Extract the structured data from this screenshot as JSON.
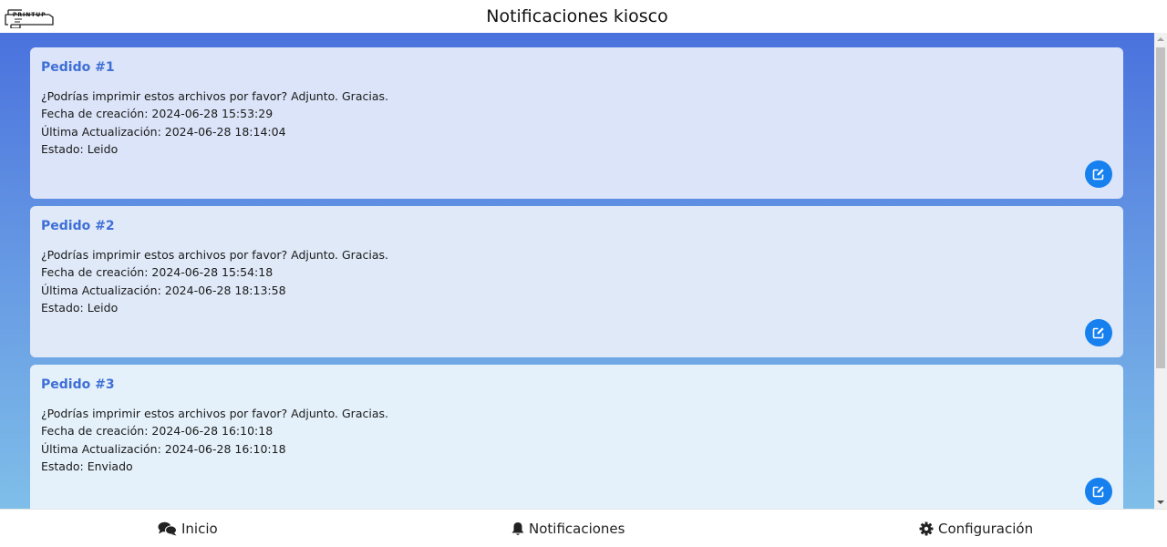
{
  "header": {
    "logo_text": "PRINTUP",
    "title": "Notificaciones kiosco"
  },
  "orders": [
    {
      "title": "Pedido #1",
      "message": "¿Podrías imprimir estos archivos por favor? Adjunto. Gracias.",
      "created": "Fecha de creación: 2024-06-28 15:53:29",
      "updated": "Última Actualización: 2024-06-28 18:14:04",
      "status": "Estado: Leido",
      "edit_icon": "edit-icon"
    },
    {
      "title": "Pedido #2",
      "message": "¿Podrías imprimir estos archivos por favor? Adjunto. Gracias.",
      "created": "Fecha de creación: 2024-06-28 15:54:18",
      "updated": "Última Actualización: 2024-06-28 18:13:58",
      "status": "Estado: Leido",
      "edit_icon": "edit-icon"
    },
    {
      "title": "Pedido #3",
      "message": "¿Podrías imprimir estos archivos por favor? Adjunto. Gracias.",
      "created": "Fecha de creación: 2024-06-28 16:10:18",
      "updated": "Última Actualización: 2024-06-28 16:10:18",
      "status": "Estado: Enviado",
      "edit_icon": "edit-icon"
    }
  ],
  "nav": {
    "home": {
      "label": "Inicio",
      "icon": "chat-bubbles-icon"
    },
    "notifications": {
      "label": "Notificaciones",
      "icon": "bell-icon"
    },
    "settings": {
      "label": "Configuración",
      "icon": "gear-icon"
    }
  },
  "colors": {
    "accent": "#1680ee",
    "title_blue": "#3f6fd6",
    "gradient_top": "#4a72dd",
    "gradient_bottom": "#7fbee9"
  }
}
